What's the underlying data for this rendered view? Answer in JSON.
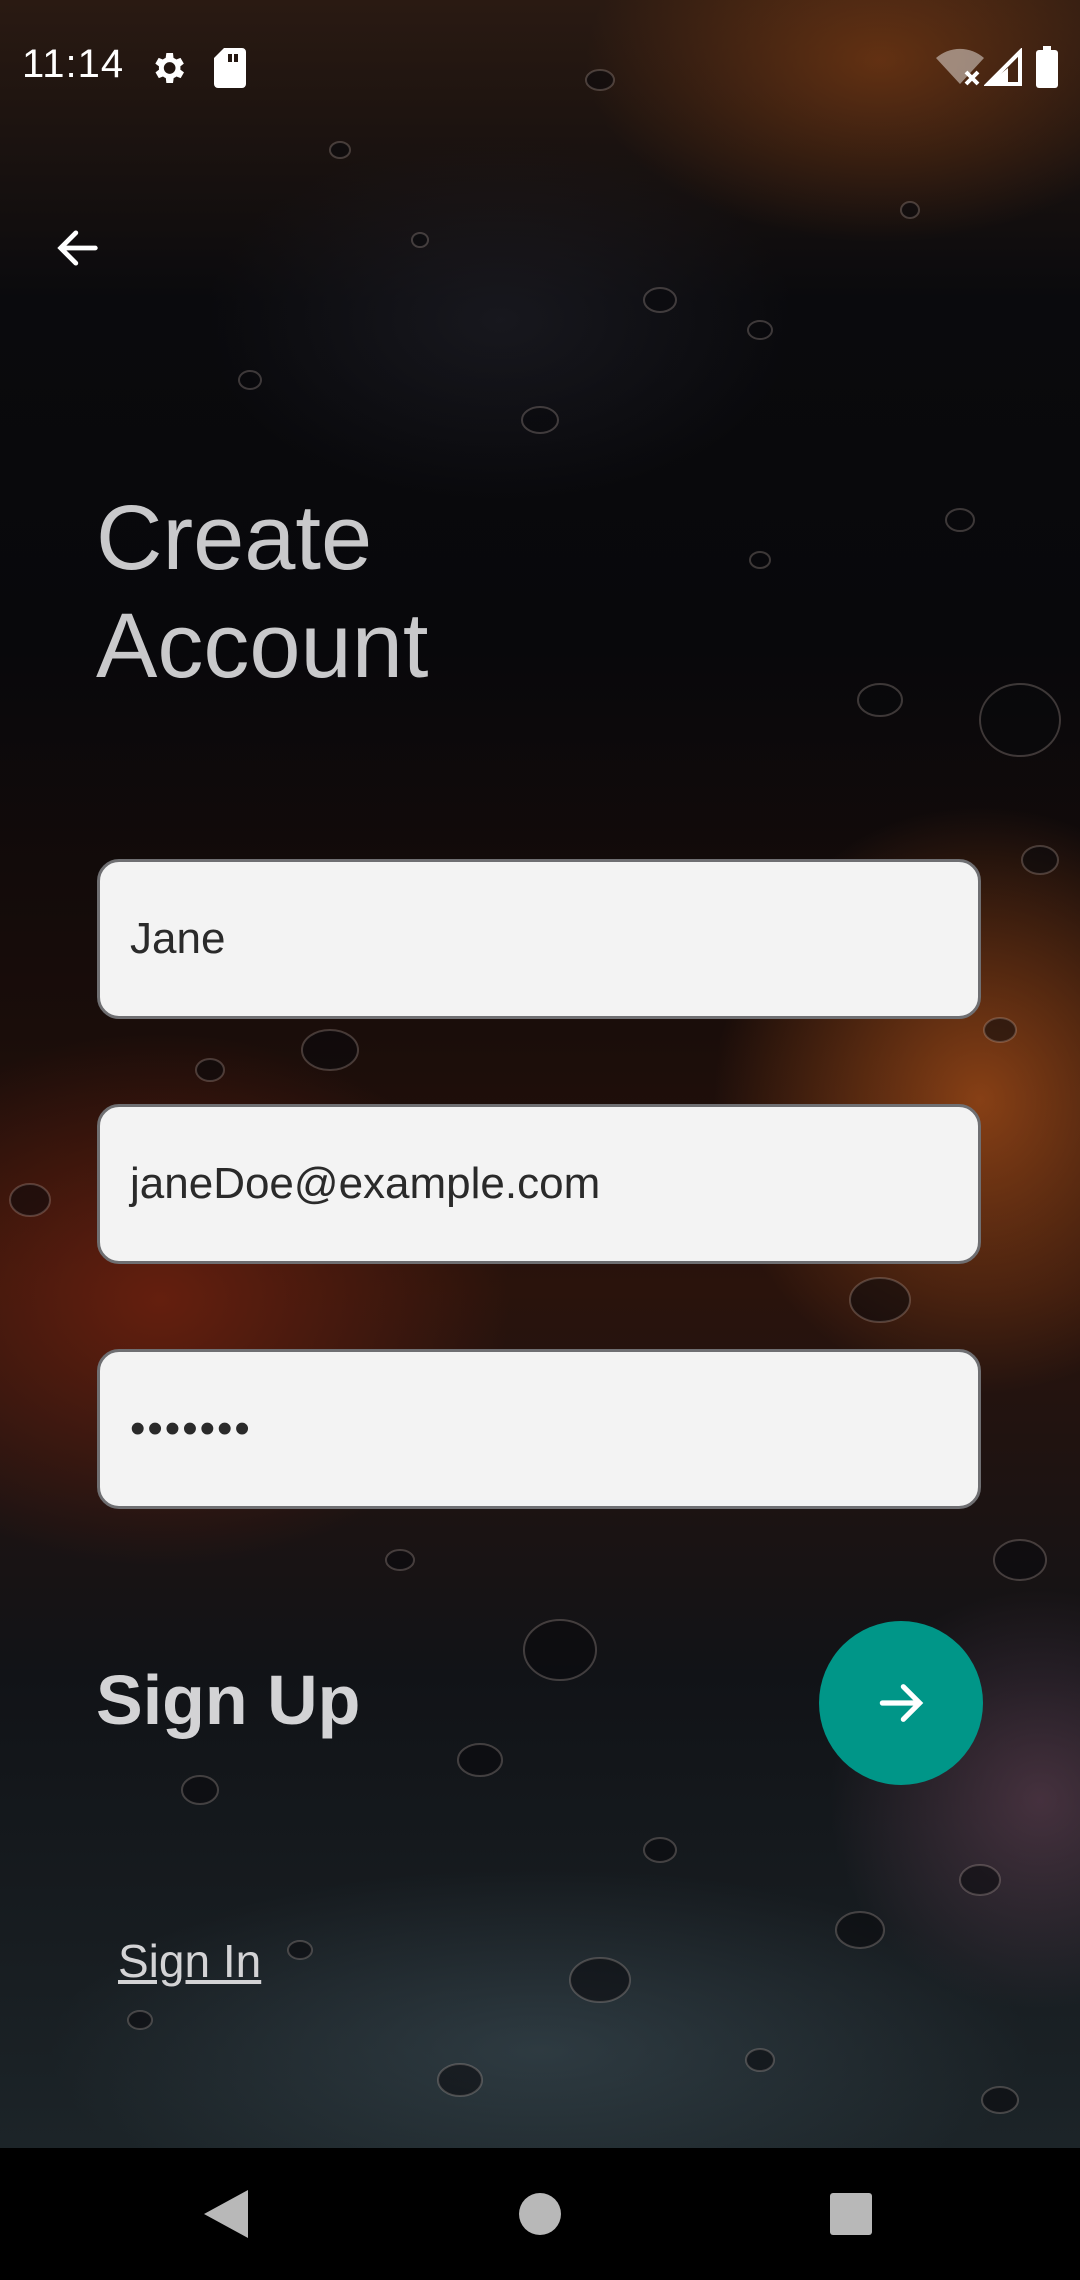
{
  "status_bar": {
    "time": "11:14",
    "icons": [
      "gear-icon",
      "sd-card-icon",
      "wifi-off-icon",
      "cell-signal-icon",
      "battery-icon"
    ]
  },
  "header": {
    "back_icon": "arrow-back-icon"
  },
  "title": {
    "line1": "Create",
    "line2": "Account"
  },
  "form": {
    "name_value": "Jane",
    "email_value": "janeDoe@example.com",
    "password_value": "•••••••"
  },
  "actions": {
    "signup_label": "Sign Up",
    "signup_icon": "arrow-forward-icon",
    "signin_label": "Sign In"
  },
  "navigation": {
    "back": "nav-back-icon",
    "home": "nav-home-icon",
    "recents": "nav-recents-icon"
  },
  "colors": {
    "accent": "#009688",
    "field_bg": "#f3f3f3",
    "title_text": "#c9c9cb"
  }
}
